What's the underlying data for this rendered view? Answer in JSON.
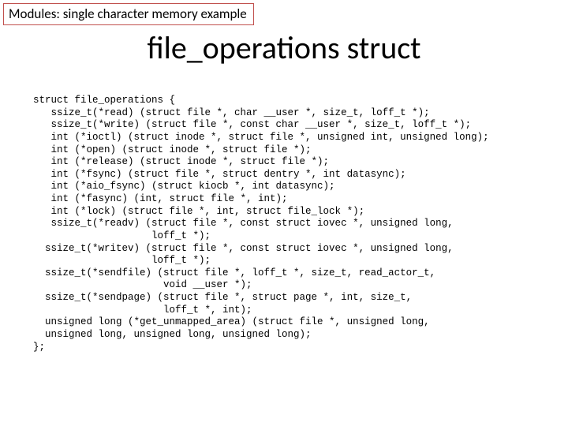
{
  "tag": "Modules: single character memory example",
  "title": "file_operations struct",
  "code_lines": [
    "struct file_operations {",
    "   ssize_t(*read) (struct file *, char __user *, size_t, loff_t *);",
    "   ssize_t(*write) (struct file *, const char __user *, size_t, loff_t *);",
    "   int (*ioctl) (struct inode *, struct file *, unsigned int, unsigned long);",
    "   int (*open) (struct inode *, struct file *);",
    "   int (*release) (struct inode *, struct file *);",
    "   int (*fsync) (struct file *, struct dentry *, int datasync);",
    "   int (*aio_fsync) (struct kiocb *, int datasync);",
    "   int (*fasync) (int, struct file *, int);",
    "   int (*lock) (struct file *, int, struct file_lock *);",
    "   ssize_t(*readv) (struct file *, const struct iovec *, unsigned long,",
    "                    loff_t *);",
    "  ssize_t(*writev) (struct file *, const struct iovec *, unsigned long,",
    "                    loff_t *);",
    "  ssize_t(*sendfile) (struct file *, loff_t *, size_t, read_actor_t,",
    "                      void __user *);",
    "  ssize_t(*sendpage) (struct file *, struct page *, int, size_t,",
    "                      loff_t *, int);",
    "  unsigned long (*get_unmapped_area) (struct file *, unsigned long,",
    "  unsigned long, unsigned long, unsigned long);",
    "};"
  ]
}
